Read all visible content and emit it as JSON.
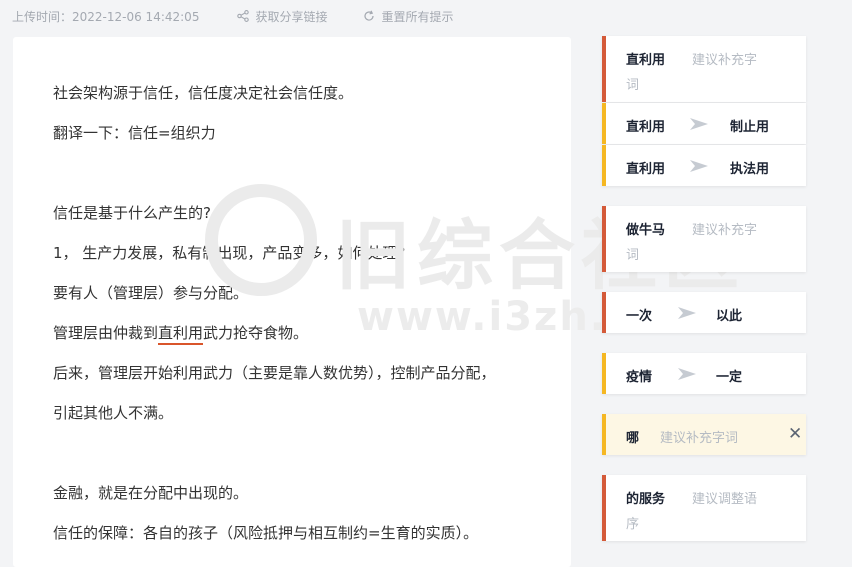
{
  "header": {
    "upload_label": "上传时间：2022-12-06 14:42:05",
    "share_label": "获取分享链接",
    "reset_label": "重置所有提示",
    "share_icon": "share-icon",
    "reset_icon": "refresh-icon"
  },
  "document": {
    "lines": [
      "社会架构源于信任，信任度决定社会信任度。",
      "翻译一下：信任=组织力",
      "",
      "信任是基于什么产生的?",
      "1， 生产力发展，私有制出现，产品变多，如何处理?",
      "要有人（管理层）参与分配。",
      {
        "before": "管理层由仲裁到",
        "marked": "直利用",
        "after": "武力抢夺食物。"
      },
      "后来，管理层开始利用武力（主要是靠人数优势），控制产品分配，",
      "引起其他人不满。",
      "",
      "金融，就是在分配中出现的。",
      "信任的保障：各自的孩子（风险抵押与相互制约=生育的实质）。"
    ]
  },
  "watermark": {
    "text": "旧综合社区",
    "url": "www.i3zh.com"
  },
  "suggestions": [
    {
      "original": "直利用",
      "hint_line1": "建议补充字",
      "hint_line2": "词",
      "color": "#d45a39"
    },
    {
      "original": "直利用",
      "replacement": "制止用",
      "color": "#f5b722"
    },
    {
      "original": "直利用",
      "replacement": "执法用",
      "color": "#f5b722"
    },
    {
      "original": "做牛马",
      "hint_line1": "建议补充字",
      "hint_line2": "词",
      "color": "#d45a39"
    },
    {
      "original": "一次",
      "replacement": "以此",
      "color": "#d45a39"
    },
    {
      "original": "疫情",
      "replacement": "一定",
      "color": "#f5b722"
    },
    {
      "original": "哪",
      "hint_line1": "建议补充字词",
      "color": "#f5b722",
      "close_symbol": "✕",
      "close_icon": "close-icon"
    },
    {
      "original": "的服务",
      "hint_line1": "建议调整语",
      "hint_line2": "序",
      "color": "#d45a39"
    }
  ]
}
